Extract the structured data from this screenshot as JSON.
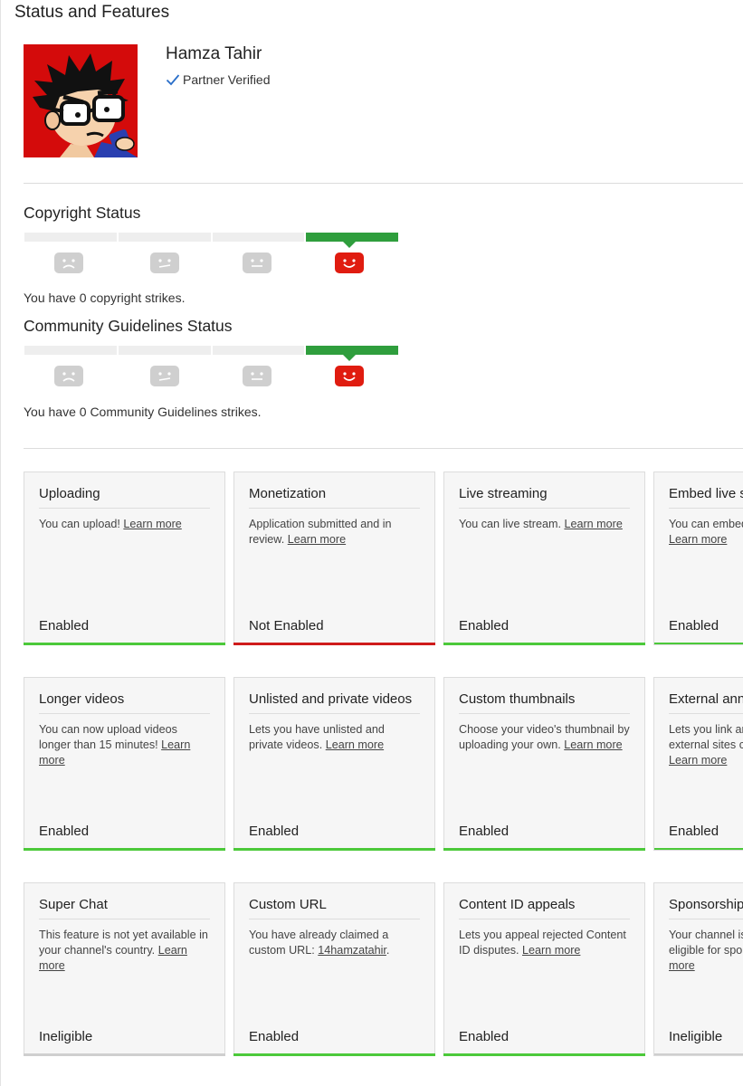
{
  "page": {
    "title": "Status and Features"
  },
  "channel": {
    "name": "Hamza Tahir",
    "badge": "Partner Verified"
  },
  "copyright": {
    "title": "Copyright Status",
    "strikes": 0,
    "message": "You have 0 copyright strikes."
  },
  "community": {
    "title": "Community Guidelines Status",
    "strikes": 0,
    "message": "You have 0 Community Guidelines strikes."
  },
  "colors": {
    "enabled": "#4cc93a",
    "not_enabled": "#cf1b1b",
    "ineligible": "#cfcfcf",
    "active_face": "#e01c10",
    "strike_bar": "#2f9e3d"
  },
  "features": [
    {
      "title": "Uploading",
      "desc": "You can upload!",
      "link": "Learn more",
      "status": "Enabled",
      "state": "enabled"
    },
    {
      "title": "Monetization",
      "desc": "Application submitted and in review.",
      "link": "Learn more",
      "status": "Not Enabled",
      "state": "not_enabled"
    },
    {
      "title": "Live streaming",
      "desc": "You can live stream.",
      "link": "Learn more",
      "status": "Enabled",
      "state": "enabled"
    },
    {
      "title": "Embed live s",
      "desc": "You can embed",
      "link": "Learn more",
      "status": "Enabled",
      "state": "enabled"
    },
    {
      "title": "Longer videos",
      "desc": "You can now upload videos longer than 15 minutes!",
      "link": "Learn more",
      "status": "Enabled",
      "state": "enabled"
    },
    {
      "title": "Unlisted and private videos",
      "desc": "Lets you have unlisted and private videos.",
      "link": "Learn more",
      "status": "Enabled",
      "state": "enabled"
    },
    {
      "title": "Custom thumbnails",
      "desc": "Choose your video's thumbnail by uploading your own.",
      "link": "Learn more",
      "status": "Enabled",
      "state": "enabled"
    },
    {
      "title": "External ann",
      "desc": "Lets you link ar external sites c",
      "link": "Learn more",
      "status": "Enabled",
      "state": "enabled"
    },
    {
      "title": "Super Chat",
      "desc": "This feature is not yet available in your channel's country.",
      "link": "Learn more",
      "status": "Ineligible",
      "state": "ineligible"
    },
    {
      "title": "Custom URL",
      "desc": "You have already claimed a custom URL:",
      "link": "14hamzatahir",
      "suffix": ".",
      "status": "Enabled",
      "state": "enabled"
    },
    {
      "title": "Content ID appeals",
      "desc": "Lets you appeal rejected Content ID disputes.",
      "link": "Learn more",
      "status": "Enabled",
      "state": "enabled"
    },
    {
      "title": "Sponsorship",
      "desc": "Your channel is eligible for spo",
      "link": "more",
      "status": "Ineligible",
      "state": "ineligible"
    }
  ]
}
